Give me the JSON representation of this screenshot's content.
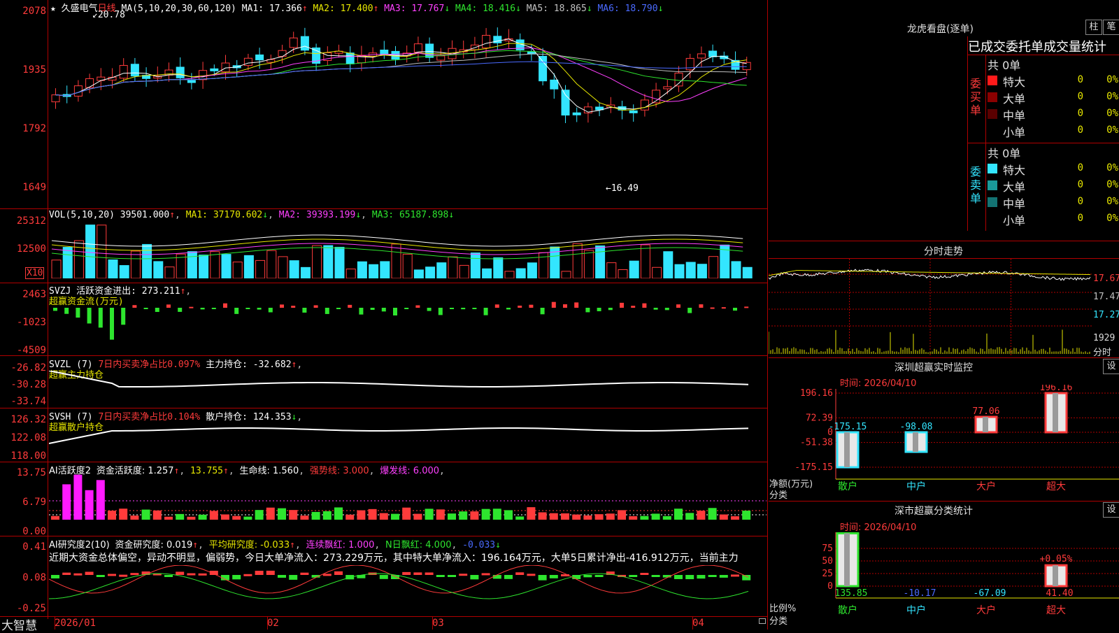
{
  "stock": {
    "name": "久盛电气",
    "period": "日线",
    "star": "★"
  },
  "price_panel": {
    "ma_label": "MA(5,10,20,30,60,120)",
    "mas": [
      {
        "text": "MA1: 17.366",
        "arrow": "↑",
        "color": "#ffffff"
      },
      {
        "text": "MA2: 17.400",
        "arrow": "↑",
        "color": "#e6e600"
      },
      {
        "text": "MA3: 17.767",
        "arrow": "↓",
        "color": "#ff40ff"
      },
      {
        "text": "MA4: 18.416",
        "arrow": "↓",
        "color": "#2ee52e"
      },
      {
        "text": "MA5: 18.865",
        "arrow": "↓",
        "color": "#c0c0c0"
      },
      {
        "text": "MA6: 18.790",
        "arrow": "↓",
        "color": "#4a6aff"
      }
    ],
    "y_ticks": [
      "2078",
      "1935",
      "1792",
      "1649"
    ],
    "high_marker": "20.78",
    "low_marker": "16.49"
  },
  "vol_panel": {
    "label": "VOL(5,10,20)",
    "value": "39501.000",
    "ma1": "MA1: 37170.602",
    "ma2": "MA2: 39393.199",
    "ma3": "MA3: 65187.898",
    "y_ticks": [
      "25312",
      "12500"
    ],
    "unit": "X10"
  },
  "svzj_panel": {
    "label": "SVZJ",
    "desc": "活跃资金进出: 273.211",
    "subtitle": "超赢资金流(万元)",
    "y_ticks": [
      "2463",
      "-1023",
      "-4509"
    ]
  },
  "svzl_panel": {
    "label": "SVZL (7)",
    "desc_red": "7日内买卖净占比0.097%",
    "desc": "主力持仓: -32.682",
    "subtitle": "超赢主力持仓",
    "y_ticks": [
      "-26.82",
      "-30.28",
      "-33.74"
    ]
  },
  "svsh_panel": {
    "label": "SVSH (7)",
    "desc_red": "7日内买卖净占比0.104%",
    "desc": "散户持仓: 124.353",
    "subtitle": "超赢散户持仓",
    "y_ticks": [
      "126.32",
      "122.08",
      "118.00"
    ]
  },
  "ai_active_panel": {
    "label": "AI活跃度2",
    "a": "资金活跃度: 1.257",
    "b": "13.755",
    "c": "生命线: 1.560",
    "d": "强势线: 3.000",
    "e": "爆发线: 6.000",
    "y_ticks": [
      "13.75",
      "6.79",
      "0.00"
    ]
  },
  "ai_research_panel": {
    "label": "AI研究度2(10)",
    "a": "资金研究度: 0.019",
    "b": "平均研究度: -0.033",
    "c": "连续飘红: 1.000",
    "d": "N日飘红: 4.000",
    "e": "-0.033",
    "commentary": "近期大资金总体偏空，异动不明显，偏弱势，今日大单净流入：273.229万元，其中特大单净流入：196.164万元，大单5日累计净出-416.912万元，当前主力",
    "y_ticks": [
      "0.41",
      "0.08",
      "-0.25"
    ]
  },
  "x_axis": {
    "labels": [
      "2026/01",
      "02",
      "03",
      "04"
    ]
  },
  "brand": "大智慧",
  "dragon_panel": {
    "title": "龙虎看盘(逐单)",
    "btn_bar": "柱",
    "btn_pen": "笔",
    "tabs": "已成交委托单成交量统计",
    "buy_side": "委买单",
    "sell_side": "委卖单",
    "buy_total": "共 0单",
    "sell_total": "共 0单",
    "buy_rows": [
      {
        "label": "特大",
        "val": "0",
        "pct": "0%",
        "color": "#ff1a1a"
      },
      {
        "label": "大单",
        "val": "0",
        "pct": "0%",
        "color": "#8b0000"
      },
      {
        "label": "中单",
        "val": "0",
        "pct": "0%",
        "color": "#5a0000"
      },
      {
        "label": "小单",
        "val": "0",
        "pct": "0%",
        "color": ""
      }
    ],
    "sell_rows": [
      {
        "label": "特大",
        "val": "0",
        "pct": "0%",
        "color": "#33e5ff"
      },
      {
        "label": "大单",
        "val": "0",
        "pct": "0%",
        "color": "#1a9a9a"
      },
      {
        "label": "中单",
        "val": "0",
        "pct": "0%",
        "color": "#137373"
      },
      {
        "label": "小单",
        "val": "0",
        "pct": "0%",
        "color": ""
      }
    ]
  },
  "intraday": {
    "title": "分时走势",
    "y_ticks": [
      "17.67",
      "17.47",
      "17.27"
    ],
    "vol_tick": "1929",
    "vol_label": "分时"
  },
  "realtime_monitor": {
    "title": "深圳超赢实时监控",
    "btn": "设",
    "time": "时间: 2026/04/10",
    "y_ticks": [
      "196.16",
      "72.39",
      "0",
      "-51.38",
      "-175.15"
    ],
    "y_label": "净额(万元)",
    "x_label": "分类",
    "categories": [
      "散户",
      "中户",
      "大户",
      "超大"
    ],
    "values": [
      -175.15,
      -98.08,
      77.06,
      196.16
    ],
    "value_labels": [
      "-175.15",
      "-98.08",
      "77.06",
      "196.16"
    ]
  },
  "class_stats": {
    "title": "深市超赢分类统计",
    "btn": "设",
    "time": "时间: 2026/04/10",
    "y_ticks": [
      "75",
      "50",
      "25",
      "0"
    ],
    "y_label": "比例%",
    "x_label": "分类",
    "categories": [
      "散户",
      "中户",
      "大户",
      "超大"
    ],
    "values": [
      135.85,
      -10.17,
      -67.09,
      41.4
    ],
    "value_labels": [
      "135.85",
      "-10.17",
      "-67.09",
      "41.40"
    ],
    "note": "+0.05%"
  },
  "colors": {
    "up": "#ff3b3b",
    "down": "#33e5ff",
    "border": "#b00000"
  }
}
